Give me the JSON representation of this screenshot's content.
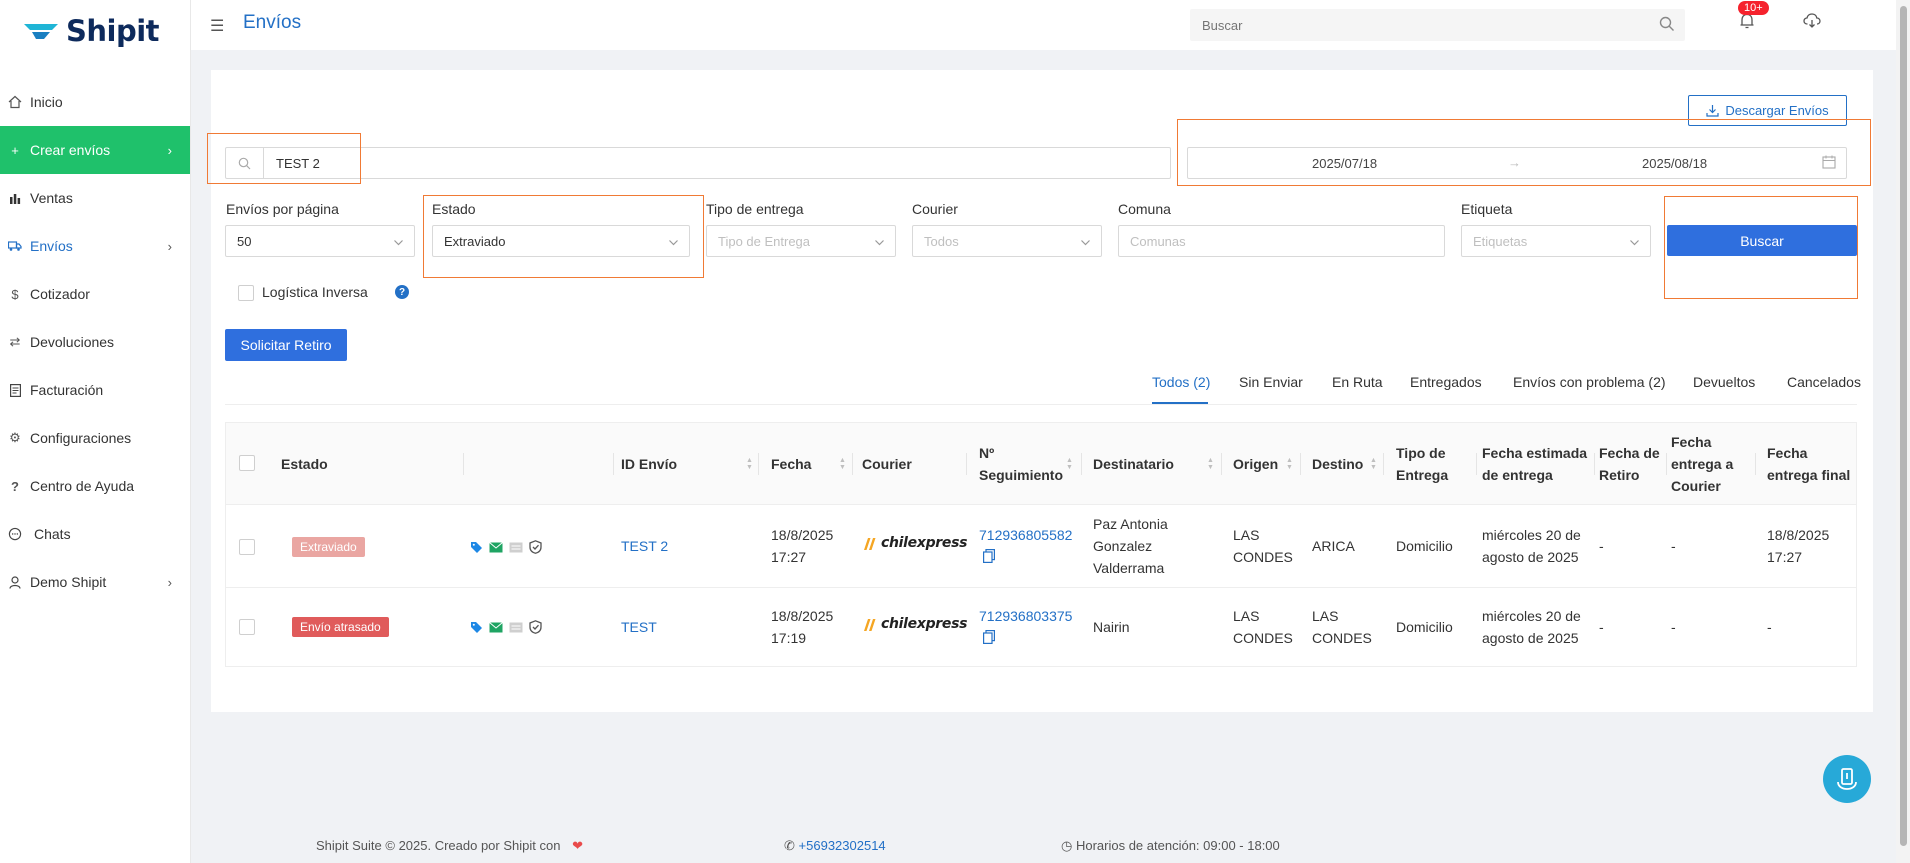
{
  "brand": {
    "name": "Shipit"
  },
  "header": {
    "title": "Envíos",
    "search_placeholder": "Buscar",
    "notif_badge": "10+"
  },
  "sidebar": {
    "items": [
      {
        "label": "Inicio",
        "icon": "home-icon"
      },
      {
        "label": "Crear envíos",
        "icon": "plus-icon"
      },
      {
        "label": "Ventas",
        "icon": "chart-icon"
      },
      {
        "label": "Envíos",
        "icon": "truck-icon"
      },
      {
        "label": "Cotizador",
        "icon": "dollar-icon"
      },
      {
        "label": "Devoluciones",
        "icon": "swap-icon"
      },
      {
        "label": "Facturación",
        "icon": "invoice-icon"
      },
      {
        "label": "Configuraciones",
        "icon": "gear-icon"
      },
      {
        "label": "Centro de Ayuda",
        "icon": "question-icon"
      },
      {
        "label": "Chats",
        "icon": "chat-icon"
      },
      {
        "label": "Demo Shipit",
        "icon": "user-icon"
      }
    ]
  },
  "toolbar": {
    "download_label": "Descargar Envíos",
    "search_value": "TEST 2",
    "date_from": "2025/07/18",
    "date_to": "2025/08/18"
  },
  "filters": {
    "per_page_label": "Envíos por página",
    "per_page_value": "50",
    "estado_label": "Estado",
    "estado_value": "Extraviado",
    "tipo_label": "Tipo de entrega",
    "tipo_placeholder": "Tipo de Entrega",
    "courier_label": "Courier",
    "courier_placeholder": "Todos",
    "comuna_label": "Comuna",
    "comuna_placeholder": "Comunas",
    "etiqueta_label": "Etiqueta",
    "etiqueta_placeholder": "Etiquetas",
    "buscar_label": "Buscar",
    "logistica_label": "Logística Inversa",
    "retiro_label": "Solicitar Retiro"
  },
  "tabs": [
    "Todos (2)",
    "Sin Enviar",
    "En Ruta",
    "Entregados",
    "Envíos con problema (2)",
    "Devueltos",
    "Cancelados"
  ],
  "table": {
    "headers": {
      "estado": "Estado",
      "id": "ID Envío",
      "fecha": "Fecha",
      "courier": "Courier",
      "seguimiento_1": "Nº",
      "seguimiento_2": "Seguimiento",
      "destinatario": "Destinatario",
      "origen": "Origen",
      "destino": "Destino",
      "tipo_1": "Tipo de",
      "tipo_2": "Entrega",
      "fecha_est_1": "Fecha estimada",
      "fecha_est_2": "de entrega",
      "retiro_1": "Fecha de",
      "retiro_2": "Retiro",
      "courier_e_1": "Fecha",
      "courier_e_2": "entrega a",
      "courier_e_3": "Courier",
      "final_1": "Fecha",
      "final_2": "entrega final"
    },
    "rows": [
      {
        "estado": "Extraviado",
        "id": "TEST 2",
        "fecha_1": "18/8/2025",
        "fecha_2": "17:27",
        "courier": "chilexpress",
        "seguimiento": "712936805582",
        "dest_1": "Paz Antonia",
        "dest_2": "Gonzalez",
        "dest_3": "Valderrama",
        "origen_1": "LAS",
        "origen_2": "CONDES",
        "destino_1": "ARICA",
        "destino_2": "",
        "tipo": "Domicilio",
        "est_1": "miércoles 20 de",
        "est_2": "agosto de 2025",
        "retiro": "-",
        "entrega_courier": "-",
        "final_1": "18/8/2025",
        "final_2": "17:27"
      },
      {
        "estado": "Envío atrasado",
        "id": "TEST",
        "fecha_1": "18/8/2025",
        "fecha_2": "17:19",
        "courier": "chilexpress",
        "seguimiento": "712936803375",
        "dest_1": "Nairin",
        "dest_2": "",
        "dest_3": "",
        "origen_1": "LAS",
        "origen_2": "CONDES",
        "destino_1": "LAS",
        "destino_2": "CONDES",
        "tipo": "Domicilio",
        "est_1": "miércoles 20 de",
        "est_2": "agosto de 2025",
        "retiro": "-",
        "entrega_courier": "-",
        "final_1": "-",
        "final_2": ""
      }
    ]
  },
  "footer": {
    "credit": "Shipit Suite © 2025. Creado por Shipit con",
    "phone": "+56932302514",
    "hours": "Horarios de atención: 09:00 - 18:00"
  },
  "colors": {
    "primary": "#2370c6",
    "green": "#1fc16b",
    "button": "#2f6fde",
    "highlight": "#f07a35"
  }
}
